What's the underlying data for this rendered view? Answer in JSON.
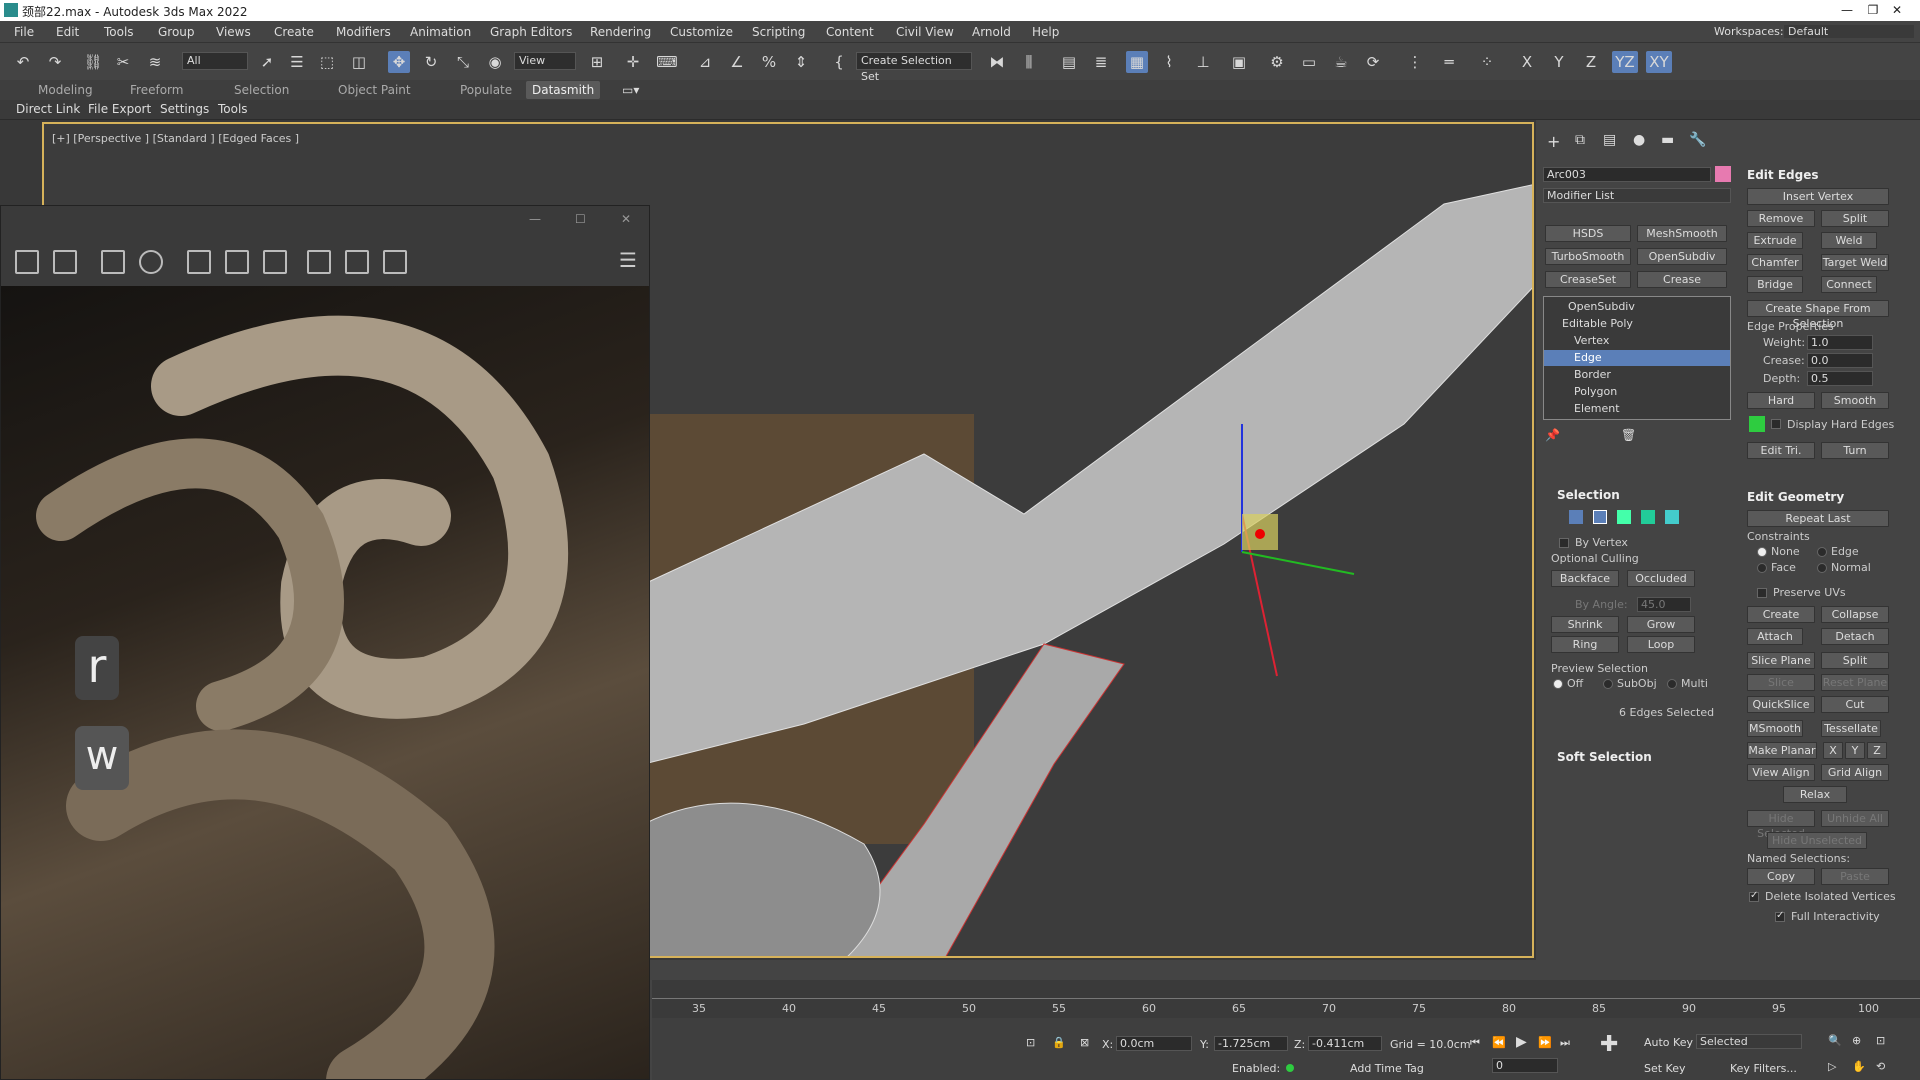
{
  "window": {
    "title": "颈部22.max - Autodesk 3ds Max 2022",
    "minimize": "—",
    "maximize": "❐",
    "close": "✕"
  },
  "menu": [
    "File",
    "Edit",
    "Tools",
    "Group",
    "Views",
    "Create",
    "Modifiers",
    "Animation",
    "Graph Editors",
    "Rendering",
    "Customize",
    "Scripting",
    "Content",
    "Civil View",
    "Arnold",
    "Help"
  ],
  "workspace": {
    "label": "Workspaces:",
    "value": "Default"
  },
  "toolbar": {
    "filter_value": "All",
    "view_value": "View",
    "selection_set": "Create Selection Set",
    "axis": [
      "X",
      "Y",
      "Z",
      "YZ",
      "XY"
    ]
  },
  "ribbon_tabs": [
    "Modeling",
    "Freeform",
    "Selection",
    "Object Paint",
    "Populate",
    "Datasmith"
  ],
  "ribbon2": [
    "Direct Link",
    "File Export",
    "Settings",
    "Tools"
  ],
  "viewport": {
    "label": "[+] [Perspective ] [Standard ] [Edged Faces ]"
  },
  "float_window": {
    "overlay_letters": [
      "r",
      "w"
    ]
  },
  "panel": {
    "object_name": "Arc003",
    "object_color": "#e77ab0",
    "modifier_list": "Modifier List",
    "quick_buttons": [
      "HSDS",
      "MeshSmooth",
      "TurboSmooth",
      "OpenSubdiv",
      "CreaseSet",
      "Crease"
    ],
    "stack": [
      {
        "label": "OpenSubdiv",
        "level": 0
      },
      {
        "label": "Editable Poly",
        "level": 0
      },
      {
        "label": "Vertex",
        "level": 1
      },
      {
        "label": "Edge",
        "level": 1,
        "selected": true
      },
      {
        "label": "Border",
        "level": 1
      },
      {
        "label": "Polygon",
        "level": 1
      },
      {
        "label": "Element",
        "level": 1
      }
    ],
    "selection": {
      "title": "Selection",
      "by_vertex": "By Vertex",
      "optional_culling": "Optional Culling",
      "backface": "Backface",
      "occluded": "Occluded",
      "by_angle": "By Angle:",
      "by_angle_value": "45.0",
      "shrink": "Shrink",
      "grow": "Grow",
      "ring": "Ring",
      "loop": "Loop",
      "preview_selection": "Preview Selection",
      "preview_options": [
        "Off",
        "SubObj",
        "Multi"
      ],
      "status": "6 Edges Selected"
    },
    "soft_selection": "Soft Selection",
    "edit_edges": {
      "title": "Edit Edges",
      "insert_vertex": "Insert Vertex",
      "remove": "Remove",
      "split": "Split",
      "extrude": "Extrude",
      "weld": "Weld",
      "chamfer": "Chamfer",
      "target_weld": "Target Weld",
      "bridge": "Bridge",
      "connect": "Connect",
      "create_shape": "Create Shape From Selection",
      "edge_properties": "Edge Properties",
      "weight_label": "Weight:",
      "weight": "1.0",
      "crease_label": "Crease:",
      "crease": "0.0",
      "depth_label": "Depth:",
      "depth": "0.5",
      "hard": "Hard",
      "smooth": "Smooth",
      "display_hard_edges": "Display Hard Edges",
      "hard_edge_color": "#2ecc40",
      "edit_tri": "Edit Tri.",
      "turn": "Turn"
    },
    "edit_geometry": {
      "title": "Edit Geometry",
      "repeat_last": "Repeat Last",
      "constraints": "Constraints",
      "none": "None",
      "edge": "Edge",
      "face": "Face",
      "normal": "Normal",
      "preserve_uvs": "Preserve UVs",
      "create": "Create",
      "collapse": "Collapse",
      "attach": "Attach",
      "detach": "Detach",
      "slice_plane": "Slice Plane",
      "split": "Split",
      "slice": "Slice",
      "reset_plane": "Reset Plane",
      "quickslice": "QuickSlice",
      "cut": "Cut",
      "msmooth": "MSmooth",
      "tessellate": "Tessellate",
      "make_planar": "Make Planar",
      "x": "X",
      "y": "Y",
      "z": "Z",
      "view_align": "View Align",
      "grid_align": "Grid Align",
      "relax": "Relax",
      "hide_selected": "Hide Selected",
      "unhide_all": "Unhide All",
      "hide_unselected": "Hide Unselected",
      "named_selections": "Named Selections:",
      "copy": "Copy",
      "paste": "Paste",
      "delete_isolated": "Delete Isolated Vertices",
      "full_interactivity": "Full Interactivity"
    }
  },
  "timeline": {
    "ticks": [
      "35",
      "40",
      "45",
      "50",
      "55",
      "60",
      "65",
      "70",
      "75",
      "80",
      "85",
      "90",
      "95",
      "100"
    ]
  },
  "status": {
    "x_label": "X:",
    "x": "0.0cm",
    "y_label": "Y:",
    "y": "-1.725cm",
    "z_label": "Z:",
    "z": "-0.411cm",
    "grid": "Grid = 10.0cm",
    "enabled": "Enabled:",
    "add_time_tag": "Add Time Tag",
    "auto_key": "Auto Key",
    "set_key": "Set Key",
    "selected": "Selected",
    "key_filters": "Key Filters...",
    "frame": "0"
  }
}
